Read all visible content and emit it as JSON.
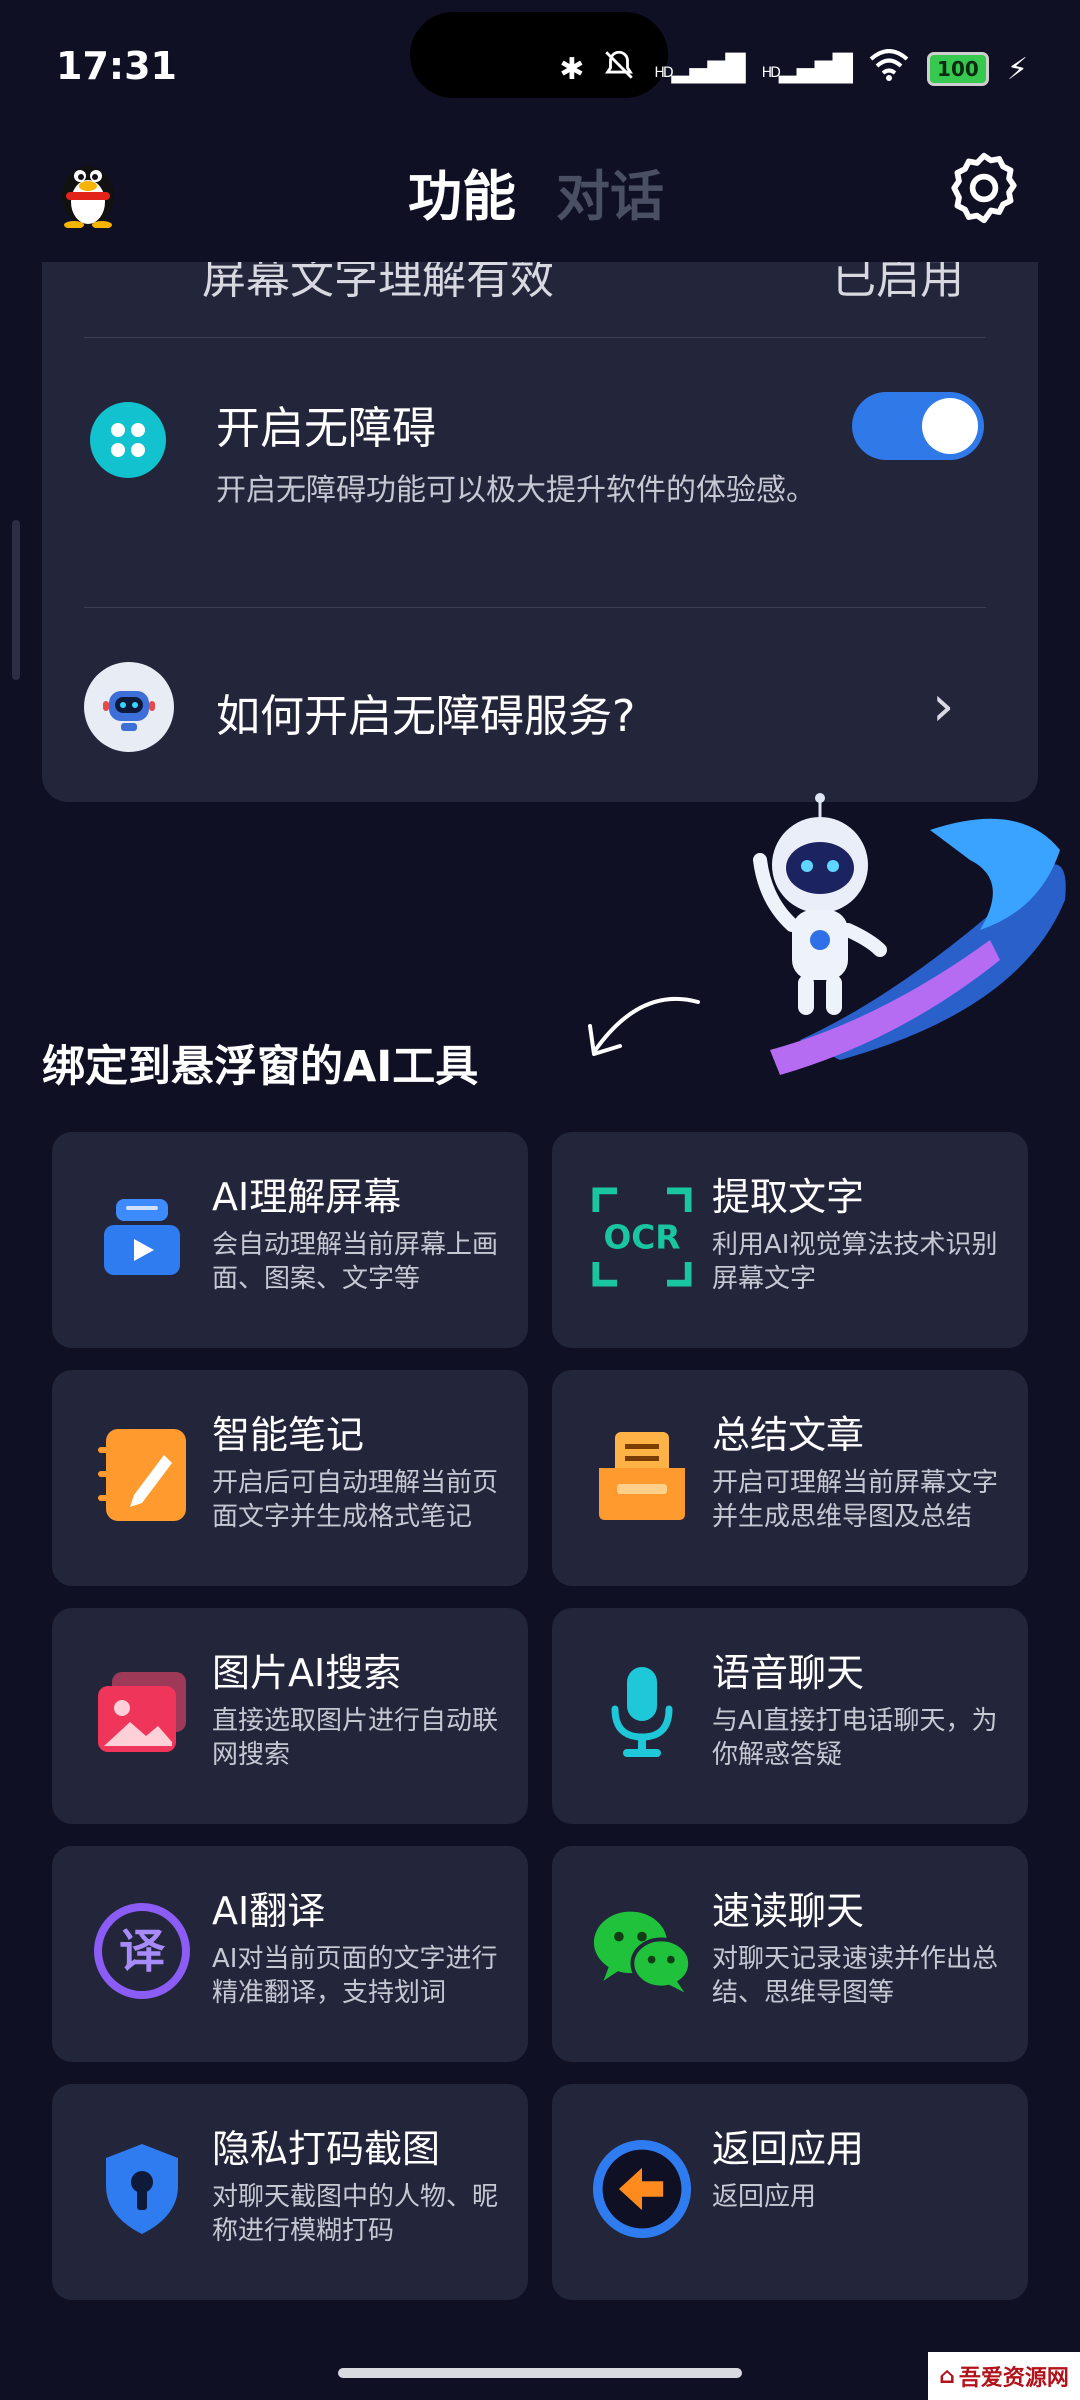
{
  "status": {
    "time": "17:31",
    "battery": "100",
    "hd1": "HD",
    "hd2": "HD"
  },
  "header": {
    "tab_active": "功能",
    "tab_inactive": "对话"
  },
  "top_card": {
    "cut_text": "屏幕文字理解有效",
    "cut_right": "已启用",
    "accessibility": {
      "title": "开启无障碍",
      "desc": "开启无障碍功能可以极大提升软件的体验感。",
      "enabled": true
    },
    "help": {
      "title": "如何开启无障碍服务?"
    }
  },
  "section": {
    "title": "绑定到悬浮窗的AI工具"
  },
  "tools": [
    {
      "title": "AI理解屏幕",
      "desc": "会自动理解当前屏幕上画面、图案、文字等",
      "icon": "screen-understand-icon"
    },
    {
      "title": "提取文字",
      "desc": "利用AI视觉算法技术识别屏幕文字",
      "icon": "ocr-icon",
      "icon_text": "OCR"
    },
    {
      "title": "智能笔记",
      "desc": "开启后可自动理解当前页面文字并生成格式笔记",
      "icon": "notebook-icon"
    },
    {
      "title": "总结文章",
      "desc": "开启可理解当前屏幕文字并生成思维导图及总结",
      "icon": "summary-icon"
    },
    {
      "title": "图片AI搜索",
      "desc": "直接选取图片进行自动联网搜索",
      "icon": "image-search-icon"
    },
    {
      "title": "语音聊天",
      "desc": "与AI直接打电话聊天，为你解惑答疑",
      "icon": "microphone-icon"
    },
    {
      "title": "AI翻译",
      "desc": "AI对当前页面的文字进行精准翻译，支持划词",
      "icon": "translate-icon",
      "icon_text": "译"
    },
    {
      "title": "速读聊天",
      "desc": "对聊天记录速读并作出总结、思维导图等",
      "icon": "wechat-icon"
    },
    {
      "title": "隐私打码截图",
      "desc": "对聊天截图中的人物、昵称进行模糊打码",
      "icon": "privacy-shield-icon"
    },
    {
      "title": "返回应用",
      "desc": "返回应用",
      "icon": "back-arrow-icon"
    }
  ],
  "watermark": "吾爱资源网",
  "colors": {
    "background": "#0f1024",
    "card": "#23253a",
    "accent": "#2f79e8",
    "teal": "#12c2cf"
  }
}
